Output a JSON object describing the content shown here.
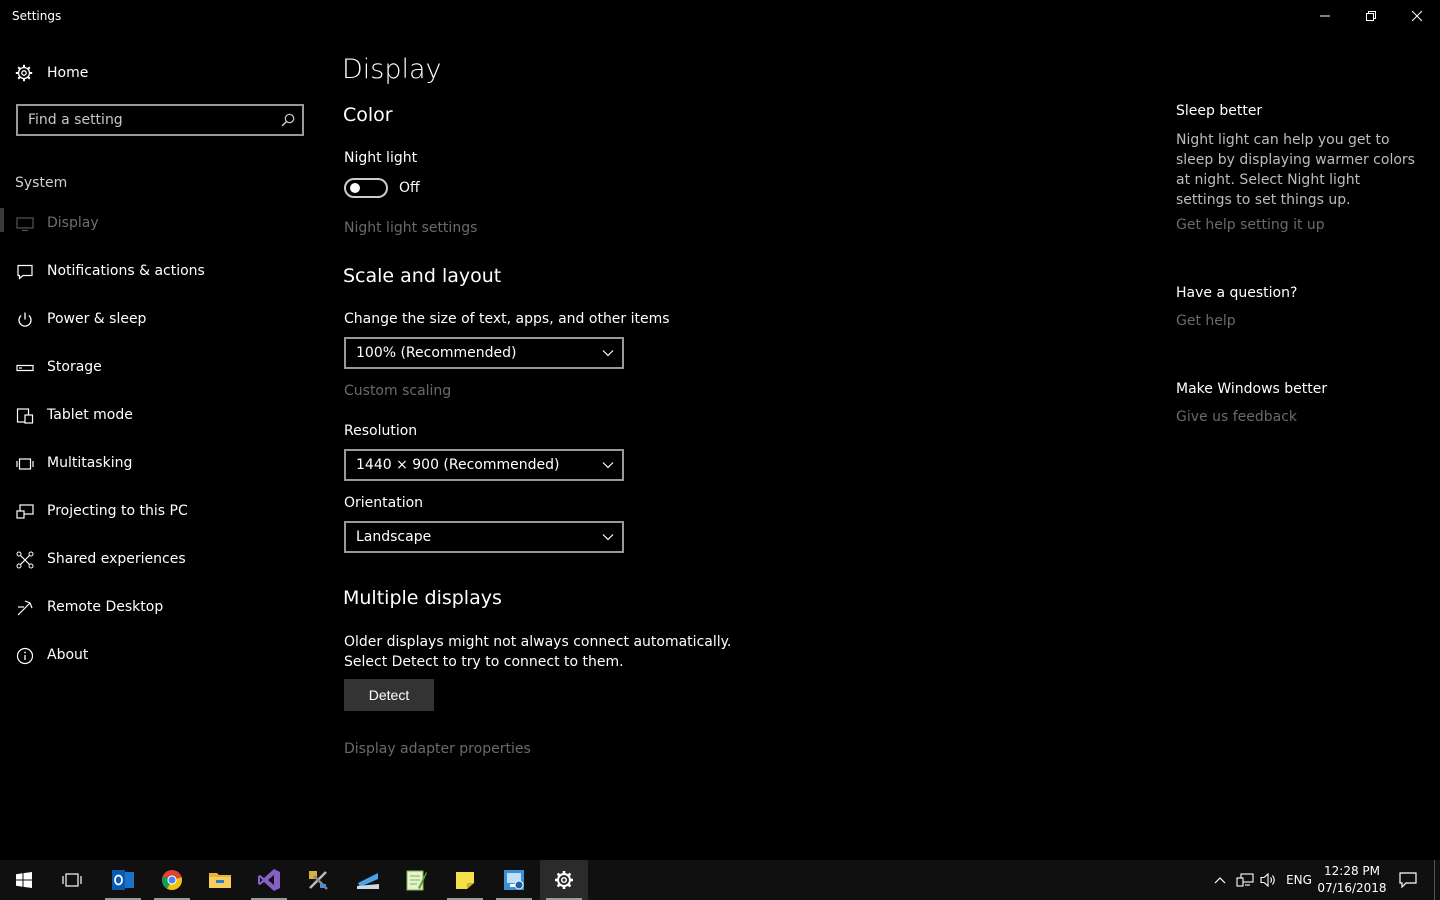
{
  "window": {
    "title": "Settings"
  },
  "sidebar": {
    "home_label": "Home",
    "search_placeholder": "Find a setting",
    "section_label": "System",
    "items": [
      {
        "label": "Display",
        "icon": "monitor-icon",
        "active": true
      },
      {
        "label": "Notifications & actions",
        "icon": "message-icon"
      },
      {
        "label": "Power & sleep",
        "icon": "power-icon"
      },
      {
        "label": "Storage",
        "icon": "storage-icon"
      },
      {
        "label": "Tablet mode",
        "icon": "tablet-icon"
      },
      {
        "label": "Multitasking",
        "icon": "multitask-icon"
      },
      {
        "label": "Projecting to this PC",
        "icon": "projector-icon"
      },
      {
        "label": "Shared experiences",
        "icon": "share-icon"
      },
      {
        "label": "Remote Desktop",
        "icon": "remote-icon"
      },
      {
        "label": "About",
        "icon": "info-icon"
      }
    ]
  },
  "main": {
    "title": "Display",
    "color": {
      "heading": "Color",
      "night_light_label": "Night light",
      "toggle_state": "Off",
      "night_light_settings": "Night light settings"
    },
    "scale": {
      "heading": "Scale and layout",
      "size_label": "Change the size of text, apps, and other items",
      "size_value": "100% (Recommended)",
      "custom_scaling": "Custom scaling",
      "resolution_label": "Resolution",
      "resolution_value": "1440 × 900 (Recommended)",
      "orientation_label": "Orientation",
      "orientation_value": "Landscape"
    },
    "multiple": {
      "heading": "Multiple displays",
      "description": "Older displays might not always connect automatically. Select Detect to try to connect to them.",
      "detect_button": "Detect",
      "adapter_link": "Display adapter properties"
    }
  },
  "right_panel": {
    "sleep_heading": "Sleep better",
    "sleep_text": "Night light can help you get to sleep by displaying warmer colors at night. Select Night light settings to set things up.",
    "sleep_link": "Get help setting it up",
    "question_heading": "Have a question?",
    "question_link": "Get help",
    "feedback_heading": "Make Windows better",
    "feedback_link": "Give us feedback"
  },
  "taskbar": {
    "apps": [
      "start-icon",
      "task-view-icon",
      "outlook-icon",
      "chrome-icon",
      "file-explorer-icon",
      "visual-studio-icon",
      "tools-icon",
      "deploy-icon",
      "notepad-plus-icon",
      "sticky-notes-icon",
      "network-app-icon",
      "settings-icon"
    ],
    "language": "ENG",
    "time": "12:28 PM",
    "date": "07/16/2018"
  },
  "colors": {
    "background": "#000000",
    "dim_text": "#6a6a6a",
    "taskbar": "#101010"
  }
}
